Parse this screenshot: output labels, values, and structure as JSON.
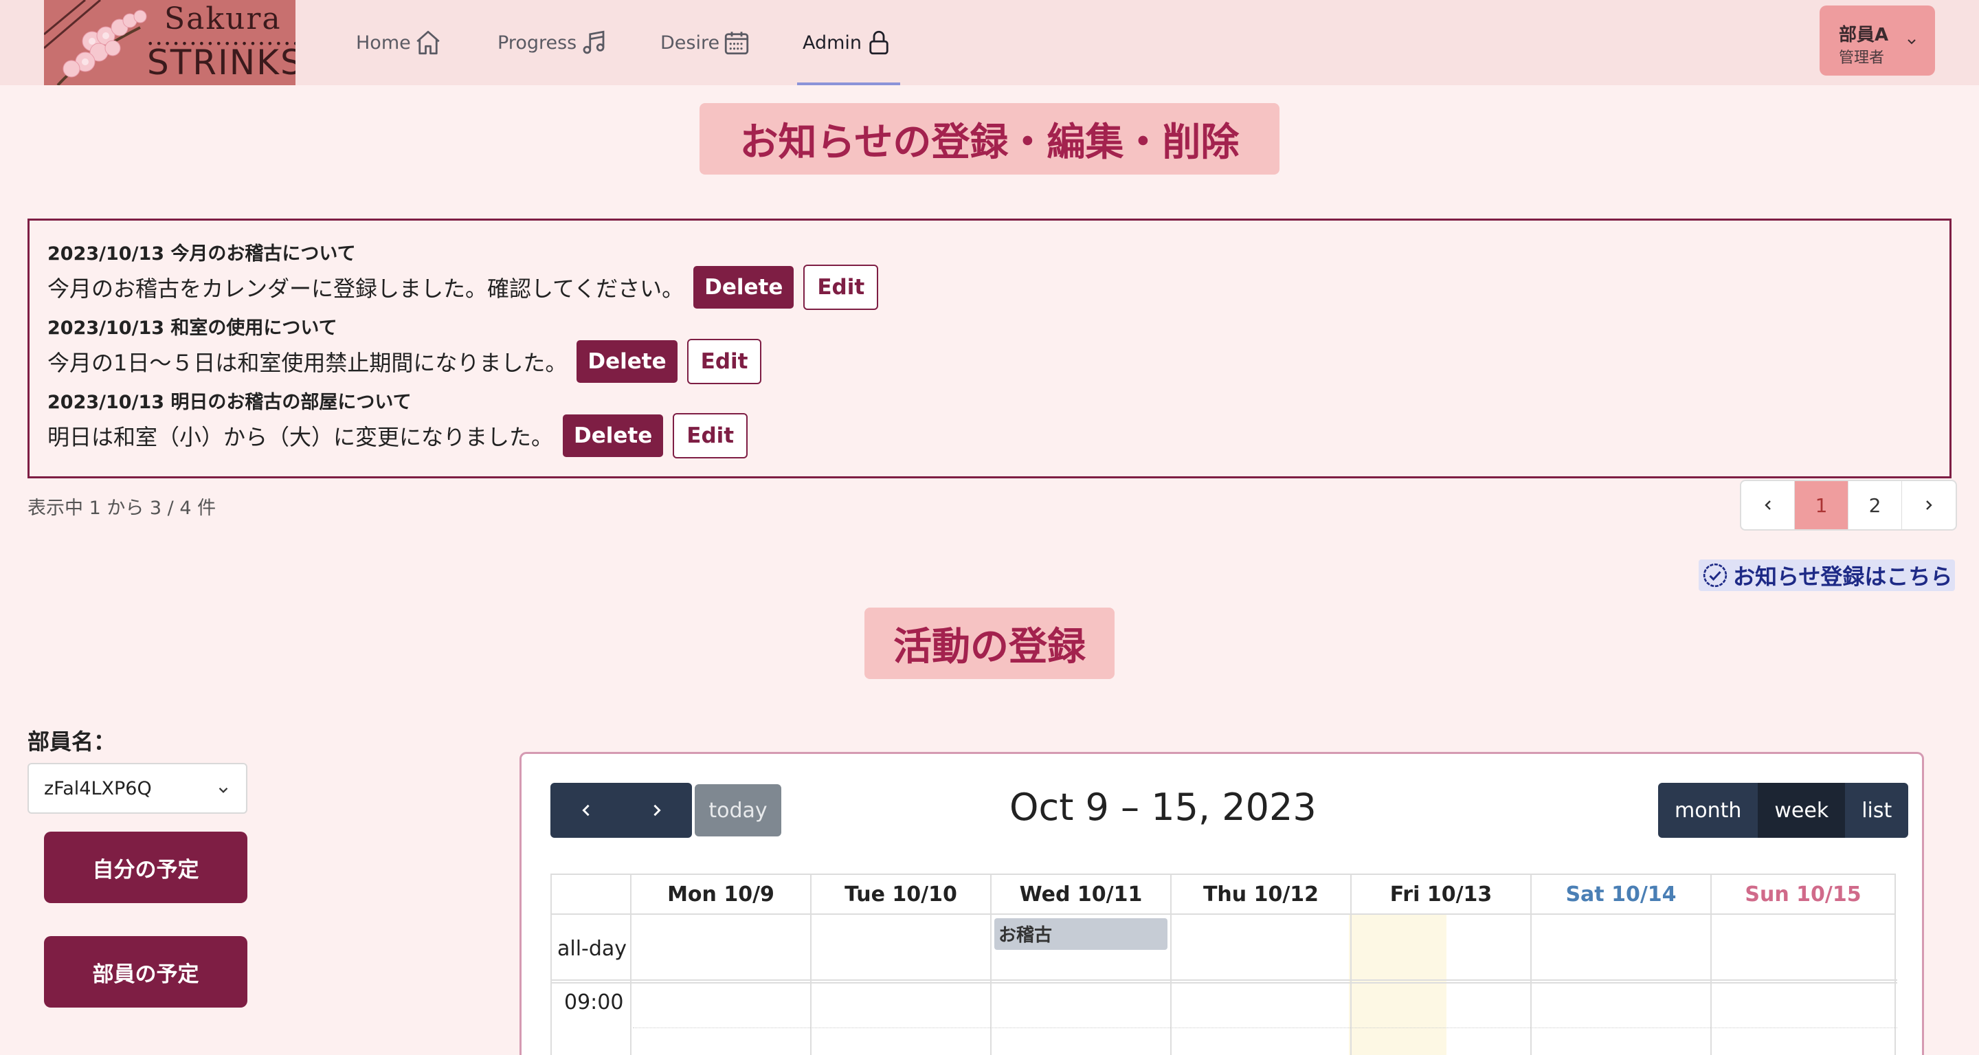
{
  "navbar": {
    "logo": {
      "line1": "Sakura",
      "dots": "••••••••••••••••••",
      "line2": "STRINKS"
    },
    "items": [
      {
        "label": "Home",
        "icon": "home-icon"
      },
      {
        "label": "Progress",
        "icon": "music-note-icon"
      },
      {
        "label": "Desire",
        "icon": "calendar-icon"
      },
      {
        "label": "Admin",
        "icon": "lock-icon",
        "active": true
      }
    ],
    "user": {
      "name": "部員A",
      "role": "管理者"
    }
  },
  "notice_section": {
    "heading": "お知らせの登録・編集・削除",
    "notices": [
      {
        "title": "2023/10/13 今月のお稽古について",
        "body": "今月のお稽古をカレンダーに登録しました。確認してください。"
      },
      {
        "title": "2023/10/13 和室の使用について",
        "body": "今月の1日〜５日は和室使用禁止期間になりました。"
      },
      {
        "title": "2023/10/13 明日のお稽古の部屋について",
        "body": "明日は和室（小）から（大）に変更になりました。"
      }
    ],
    "delete_label": "Delete",
    "edit_label": "Edit",
    "count_text": "表示中 1 から 3 / 4 件",
    "pagination": {
      "prev": "‹",
      "pages": [
        "1",
        "2"
      ],
      "current": "1",
      "next": "›"
    },
    "register_link": "お知らせ登録はこちら"
  },
  "activity_section": {
    "heading": "活動の登録",
    "member_label": "部員名：",
    "member_select_value": "zFal4LXP6Q",
    "my_schedule_button": "自分の予定",
    "member_schedule_button": "部員の予定"
  },
  "calendar": {
    "title": "Oct 9 – 15, 2023",
    "today_label": "today",
    "views": [
      "month",
      "week",
      "list"
    ],
    "active_view": "week",
    "days": [
      {
        "label": "Mon 10/9",
        "color": "#222222"
      },
      {
        "label": "Tue 10/10",
        "color": "#222222"
      },
      {
        "label": "Wed 10/11",
        "color": "#222222"
      },
      {
        "label": "Thu 10/12",
        "color": "#222222"
      },
      {
        "label": "Fri 10/13",
        "color": "#222222"
      },
      {
        "label": "Sat 10/14",
        "color": "#4a7fb5"
      },
      {
        "label": "Sun 10/15",
        "color": "#d06a8a"
      }
    ],
    "allday_label": "all-day",
    "time_label": "09:00",
    "events": [
      {
        "title": "お稽古",
        "day": "Wed 10/11",
        "all_day": true
      }
    ]
  },
  "colors": {
    "primary": "#7e1e44",
    "heading_bg": "#f6c3c3",
    "heading_text": "#a3224e",
    "navbar_bg": "#f8e1e1",
    "page_bg": "#fdf0f0",
    "calendar_button": "#2b394f"
  }
}
